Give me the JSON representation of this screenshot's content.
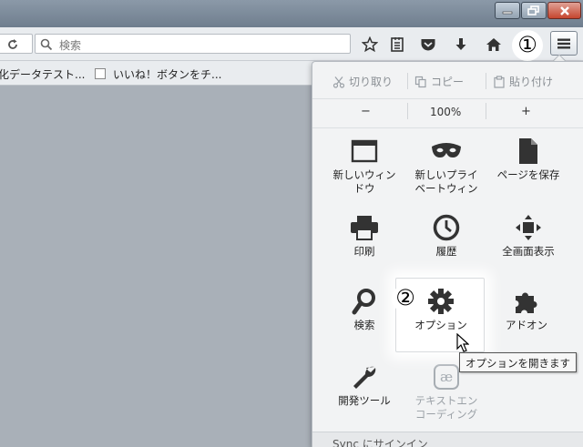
{
  "navbar": {
    "search_placeholder": "検索",
    "step1_marker": "①"
  },
  "bookmarks": {
    "item1": "化データテスト...",
    "item2": "いいね！ボタンをチ..."
  },
  "menu": {
    "edit": {
      "cut": "切り取り",
      "copy": "コピー",
      "paste": "貼り付け"
    },
    "zoom": {
      "out": "−",
      "level": "100%",
      "in": "+"
    },
    "items": [
      {
        "label": "新しいウィン\nドウ",
        "icon": "window-icon"
      },
      {
        "label": "新しいプライ\nベートウィン",
        "icon": "mask-icon"
      },
      {
        "label": "ページを保存",
        "icon": "page-icon"
      },
      {
        "label": "印刷",
        "icon": "printer-icon"
      },
      {
        "label": "履歴",
        "icon": "clock-icon"
      },
      {
        "label": "全画面表示",
        "icon": "fullscreen-icon"
      },
      {
        "label": "検索",
        "icon": "magnifier-icon"
      },
      {
        "label": "オプション",
        "icon": "gear-icon"
      },
      {
        "label": "アドオン",
        "icon": "puzzle-icon"
      },
      {
        "label": "開発ツール",
        "icon": "wrench-icon"
      },
      {
        "label": "テキストエン\nコーディング",
        "icon": "encoding-icon"
      }
    ],
    "step2_marker": "②",
    "tooltip": "オプションを開きます",
    "footer": "Sync にサインイン"
  }
}
